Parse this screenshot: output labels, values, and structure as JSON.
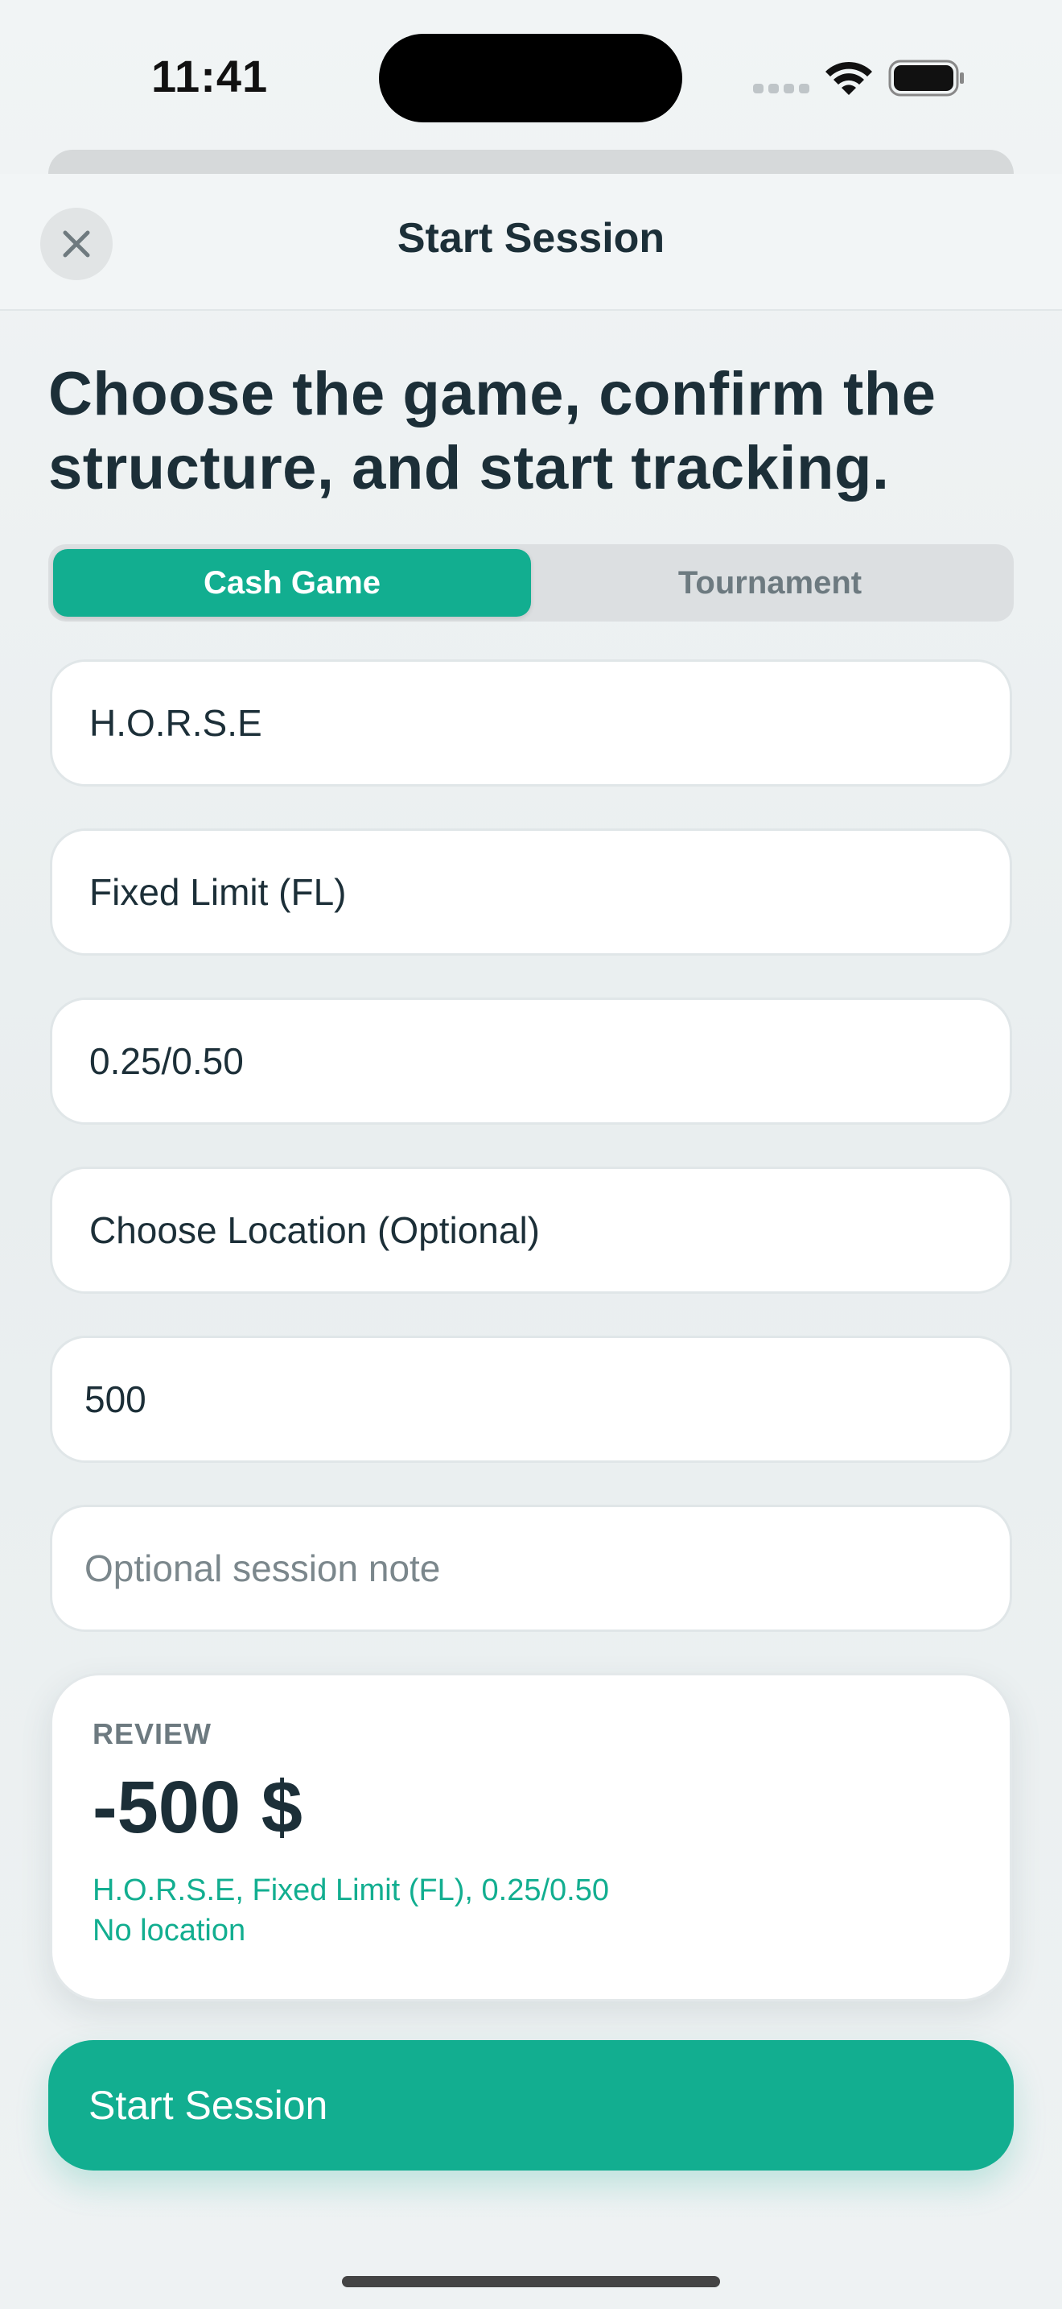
{
  "status_bar": {
    "time": "11:41"
  },
  "nav": {
    "title": "Start Session"
  },
  "headline": "Choose the game, confirm the structure, and start tracking.",
  "segments": [
    {
      "label": "Cash Game",
      "selected": true
    },
    {
      "label": "Tournament",
      "selected": false
    }
  ],
  "fields": {
    "game": {
      "value": "H.O.R.S.E"
    },
    "limit": {
      "value": "Fixed Limit (FL)"
    },
    "stakes": {
      "value": "0.25/0.50"
    },
    "location": {
      "value": "Choose Location (Optional)"
    },
    "buy_in": {
      "value": "500"
    },
    "note": {
      "value": "",
      "placeholder": "Optional session note"
    }
  },
  "review": {
    "label": "REVIEW",
    "amount": "-500 $",
    "summary_line": "H.O.R.S.E, Fixed Limit (FL), 0.25/0.50",
    "location_line": "No location"
  },
  "start_button_label": "Start Session",
  "colors": {
    "accent": "#12ae90",
    "text": "#1c2f38",
    "muted": "#6d7a80"
  },
  "icons": {
    "close": "close-icon",
    "wifi": "wifi-icon",
    "battery": "battery-icon",
    "signal": "signal-icon"
  }
}
